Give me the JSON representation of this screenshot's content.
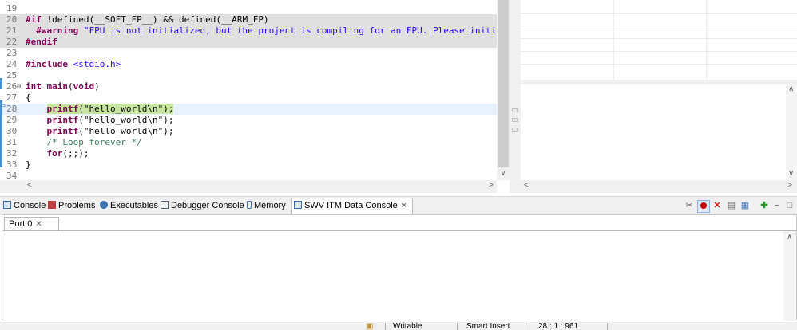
{
  "editor": {
    "lines": [
      {
        "n": "19",
        "parts": []
      },
      {
        "n": "20",
        "bg": "inactive",
        "parts": [
          {
            "t": "#if",
            "c": "kw"
          },
          {
            "t": " !defined(__SOFT_FP__) && defined(__ARM_FP)",
            "c": ""
          }
        ]
      },
      {
        "n": "21",
        "bg": "inactive",
        "parts": [
          {
            "t": "  #warning",
            "c": "kw"
          },
          {
            "t": " \"FPU is not initialized, but the project is compiling for an FPU. Please initialize",
            "c": "str"
          }
        ]
      },
      {
        "n": "22",
        "bg": "inactive",
        "parts": [
          {
            "t": "#endif",
            "c": "kw"
          }
        ]
      },
      {
        "n": "23",
        "parts": []
      },
      {
        "n": "24",
        "parts": [
          {
            "t": "#include",
            "c": "kw"
          },
          {
            "t": " <stdio.h>",
            "c": "str"
          }
        ]
      },
      {
        "n": "25",
        "parts": []
      },
      {
        "n": "26",
        "fold": "⊖",
        "parts": [
          {
            "t": "int",
            "c": "kw"
          },
          {
            "t": " ",
            "c": ""
          },
          {
            "t": "main",
            "c": "kw"
          },
          {
            "t": "(",
            "c": ""
          },
          {
            "t": "void",
            "c": "kw"
          },
          {
            "t": ")",
            "c": ""
          }
        ]
      },
      {
        "n": "27",
        "parts": [
          {
            "t": "{",
            "c": ""
          }
        ]
      },
      {
        "n": "28",
        "bg": "current",
        "parts": [
          {
            "t": "    ",
            "c": ""
          },
          {
            "t": "printf",
            "c": "kw hl"
          },
          {
            "t": "(\"hello_world\\n\");",
            "c": "hl"
          }
        ]
      },
      {
        "n": "29",
        "parts": [
          {
            "t": "    ",
            "c": ""
          },
          {
            "t": "printf",
            "c": "kw"
          },
          {
            "t": "(\"hello_world\\n\");",
            "c": ""
          }
        ]
      },
      {
        "n": "30",
        "parts": [
          {
            "t": "    ",
            "c": ""
          },
          {
            "t": "printf",
            "c": "kw"
          },
          {
            "t": "(\"hello_world\\n\");",
            "c": ""
          }
        ]
      },
      {
        "n": "31",
        "parts": [
          {
            "t": "    /* Loop forever */",
            "c": "cmt"
          }
        ]
      },
      {
        "n": "32",
        "parts": [
          {
            "t": "    ",
            "c": ""
          },
          {
            "t": "for",
            "c": "kw"
          },
          {
            "t": "(;;);",
            "c": ""
          }
        ]
      },
      {
        "n": "33",
        "parts": [
          {
            "t": "}",
            "c": ""
          }
        ]
      },
      {
        "n": "34",
        "parts": []
      }
    ]
  },
  "tabs": [
    {
      "id": "console",
      "label": "Console",
      "icon": "console-icon",
      "color": "#3a6fb0"
    },
    {
      "id": "problems",
      "label": "Problems",
      "icon": "problems-icon",
      "color": "#c04040"
    },
    {
      "id": "executables",
      "label": "Executables",
      "icon": "executables-icon",
      "color": "#3a6fb0"
    },
    {
      "id": "debugger-console",
      "label": "Debugger Console",
      "icon": "debugger-console-icon",
      "color": "#506070"
    },
    {
      "id": "memory",
      "label": "Memory",
      "icon": "memory-icon",
      "color": "#3a6fb0"
    },
    {
      "id": "swv-itm",
      "label": "SWV ITM Data Console",
      "icon": "swv-console-icon",
      "color": "#3a6fb0",
      "active": true
    }
  ],
  "console": {
    "port_tab": "Port 0"
  },
  "status": {
    "mode": "Writable",
    "insert": "Smart Insert",
    "position": "28 : 1 : 961"
  },
  "colors": {
    "keyword": "#7f0055",
    "string": "#2a00ff",
    "comment": "#3f7f5f",
    "record_red": "#c00000",
    "delete_red": "#d02020",
    "add_green": "#2a9a2a"
  }
}
